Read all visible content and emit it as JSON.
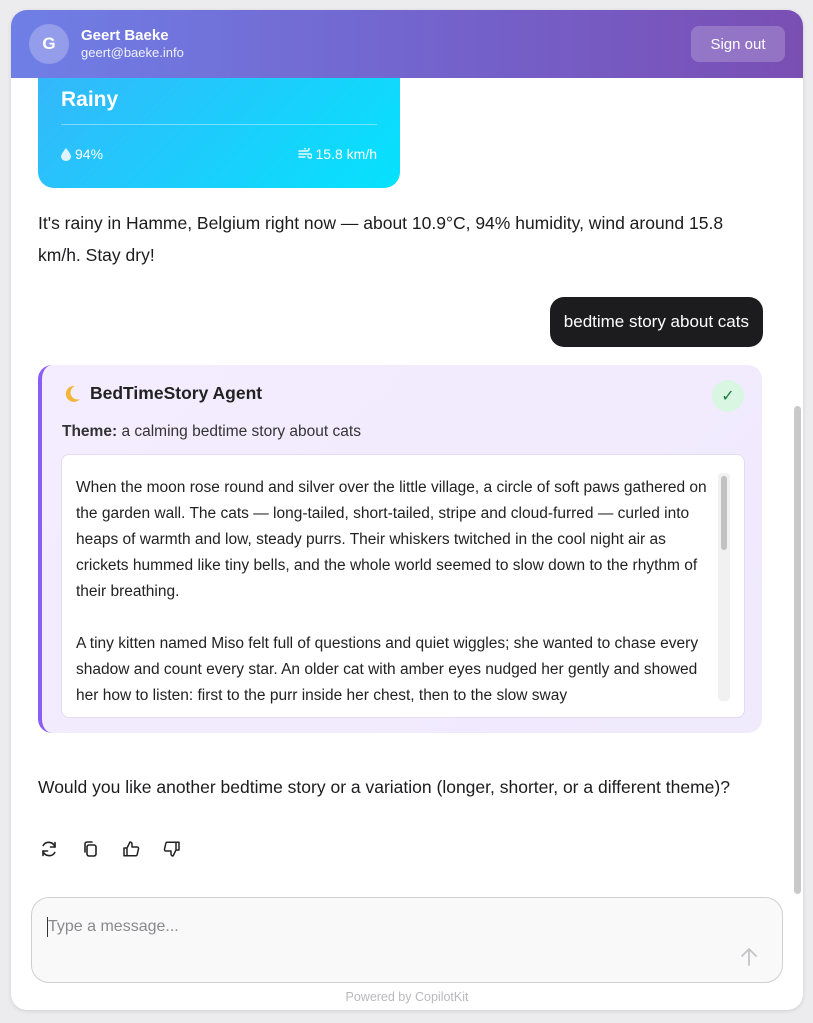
{
  "header": {
    "avatar_letter": "G",
    "user_name": "Geert Baeke",
    "user_email": "geert@baeke.info",
    "signout_label": "Sign out"
  },
  "weather_card": {
    "condition": "Rainy",
    "humidity": "94%",
    "wind": "15.8 km/h",
    "humidity_icon": "droplet-icon",
    "wind_icon": "wind-icon"
  },
  "messages": {
    "assistant_weather": "It's rainy in Hamme, Belgium right now — about 10.9°C, 94% humidity, wind around 15.8 km/h. Stay dry!",
    "user_message": "bedtime story about cats",
    "assistant_followup": "Would you like another bedtime story or a variation (longer, shorter, or a different theme)?"
  },
  "agent_card": {
    "icon": "moon-icon",
    "title": "BedTimeStory Agent",
    "status_icon": "check-icon",
    "theme_label": "Theme:",
    "theme_value": "a calming bedtime story about cats",
    "story_paragraphs": [
      "When the moon rose round and silver over the little village, a circle of soft paws gathered on the garden wall. The cats — long-tailed, short-tailed, stripe and cloud-furred — curled into heaps of warmth and low, steady purrs. Their whiskers twitched in the cool night air as crickets hummed like tiny bells, and the whole world seemed to slow down to the rhythm of their breathing.",
      "A tiny kitten named Miso felt full of questions and quiet wiggles; she wanted to chase every shadow and count every star. An older cat with amber eyes nudged her gently and showed her how to listen: first to the purr inside her chest, then to the slow sway"
    ]
  },
  "message_actions": [
    "refresh-icon",
    "copy-icon",
    "thumbs-up-icon",
    "thumbs-down-icon"
  ],
  "composer": {
    "placeholder": "Type a message...",
    "send_icon": "arrow-up-icon"
  },
  "footer": {
    "powered_by": "Powered by CopilotKit"
  },
  "colors": {
    "header_start": "#6f7fe6",
    "header_end": "#7a4fb4",
    "weather_start": "#37b5fb",
    "weather_end": "#05e2fd",
    "agent_accent": "#8b5cf6",
    "user_bubble": "#1c1c1e"
  }
}
